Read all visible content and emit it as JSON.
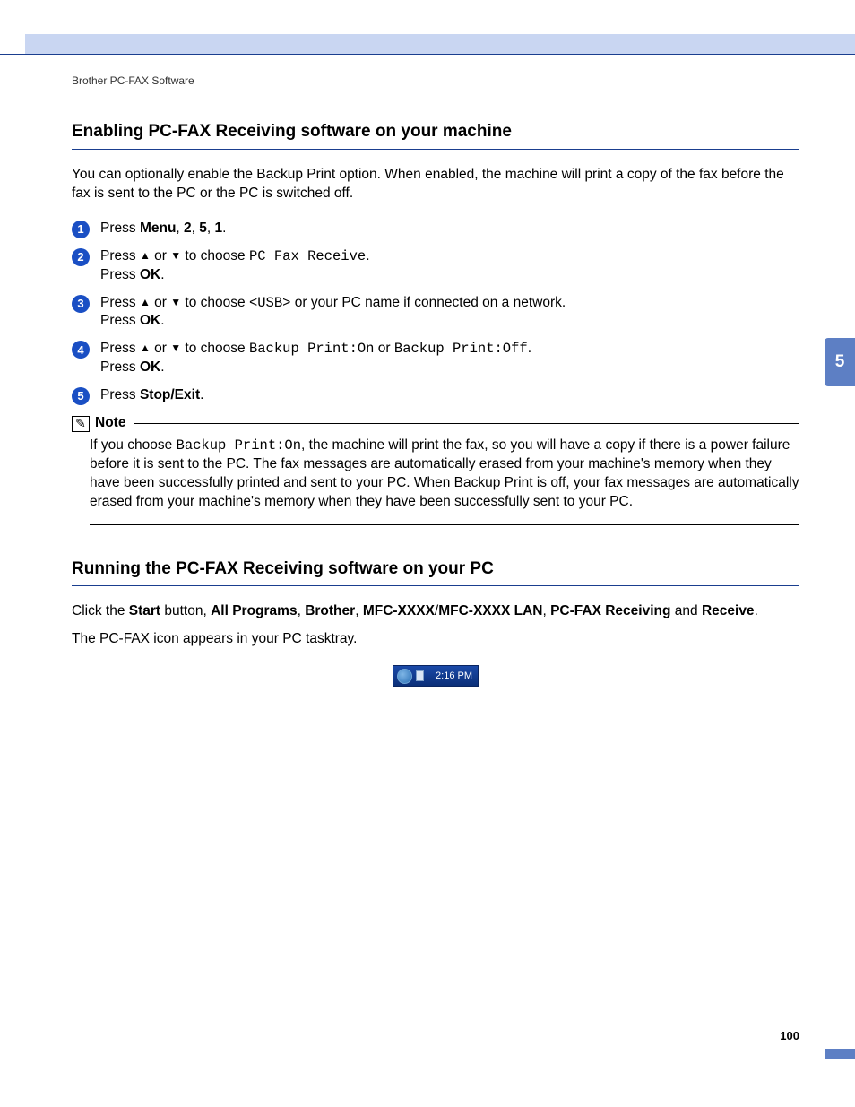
{
  "header_path": "Brother PC-FAX Software",
  "chapter_tab": "5",
  "page_number": "100",
  "section1": {
    "title": "Enabling PC-FAX Receiving software on your machine",
    "intro": "You can optionally enable the Backup Print option. When enabled, the machine will print a copy of the fax before the fax is sent to the PC or the PC is switched off.",
    "steps": [
      {
        "n": "1",
        "pre": "Press ",
        "bold1": "Menu",
        "mid": ", ",
        "bold2": "2",
        "mid2": ", ",
        "bold3": "5",
        "mid3": ", ",
        "bold4": "1",
        "post": "."
      },
      {
        "n": "2",
        "line1_a": "Press ",
        "line1_b": " or ",
        "line1_c": " to choose ",
        "mono1": "PC Fax Receive",
        "line1_d": ".",
        "line2_a": "Press ",
        "line2_bold": "OK",
        "line2_b": "."
      },
      {
        "n": "3",
        "line1_a": "Press ",
        "line1_b": " or ",
        "line1_c": " to choose ",
        "mono1": "<USB>",
        "line1_d": " or your PC name if connected on a network.",
        "line2_a": "Press ",
        "line2_bold": "OK",
        "line2_b": "."
      },
      {
        "n": "4",
        "line1_a": "Press ",
        "line1_b": " or ",
        "line1_c": " to choose ",
        "mono1": "Backup Print:On",
        "line1_d": " or ",
        "mono2": "Backup Print:Off",
        "line1_e": ".",
        "line2_a": "Press ",
        "line2_bold": "OK",
        "line2_b": "."
      },
      {
        "n": "5",
        "pre": "Press ",
        "bold1": "Stop/Exit",
        "post": "."
      }
    ],
    "note": {
      "label": "Note",
      "body_a": "If you choose ",
      "body_mono": "Backup Print:On",
      "body_b": ", the machine will print the fax, so you will have a copy if there is a power failure before it is sent to the PC. The fax messages are automatically erased from your machine's memory when they have been successfully printed and sent to your PC. When Backup Print is off, your fax messages are automatically erased from your machine's memory when they have been successfully sent to your PC."
    }
  },
  "section2": {
    "title": "Running the PC-FAX Receiving software on your PC",
    "p1_a": "Click the ",
    "p1_b1": "Start",
    "p1_c": " button, ",
    "p1_b2": "All Programs",
    "p1_d": ", ",
    "p1_b3": "Brother",
    "p1_e": ", ",
    "p1_b4": "MFC-XXXX",
    "p1_f": "/",
    "p1_b5": "MFC-XXXX LAN",
    "p1_g": ", ",
    "p1_b6": "PC-FAX Receiving",
    "p1_h": " and ",
    "p1_b7": "Receive",
    "p1_i": ".",
    "p2": "The PC-FAX icon appears in your PC tasktray.",
    "tray_time": "2:16 PM"
  },
  "arrows": {
    "up": "▲",
    "down": "▼"
  }
}
